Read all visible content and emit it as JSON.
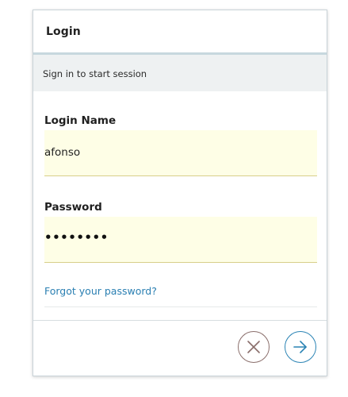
{
  "header": {
    "title": "Login"
  },
  "subheader": {
    "text": "Sign in to start session"
  },
  "form": {
    "login_name_label": "Login Name",
    "login_name_value": "afonso",
    "password_label": "Password",
    "password_value": "••••••••",
    "forgot_link": "Forgot your password?"
  },
  "actions": {
    "cancel_icon": "close-circle-icon",
    "submit_icon": "arrow-right-circle-icon"
  },
  "colors": {
    "field_background": "#fefee6",
    "link": "#2a7fb2",
    "cancel_accent": "#8a6e6b",
    "submit_accent": "#2a83b4"
  }
}
